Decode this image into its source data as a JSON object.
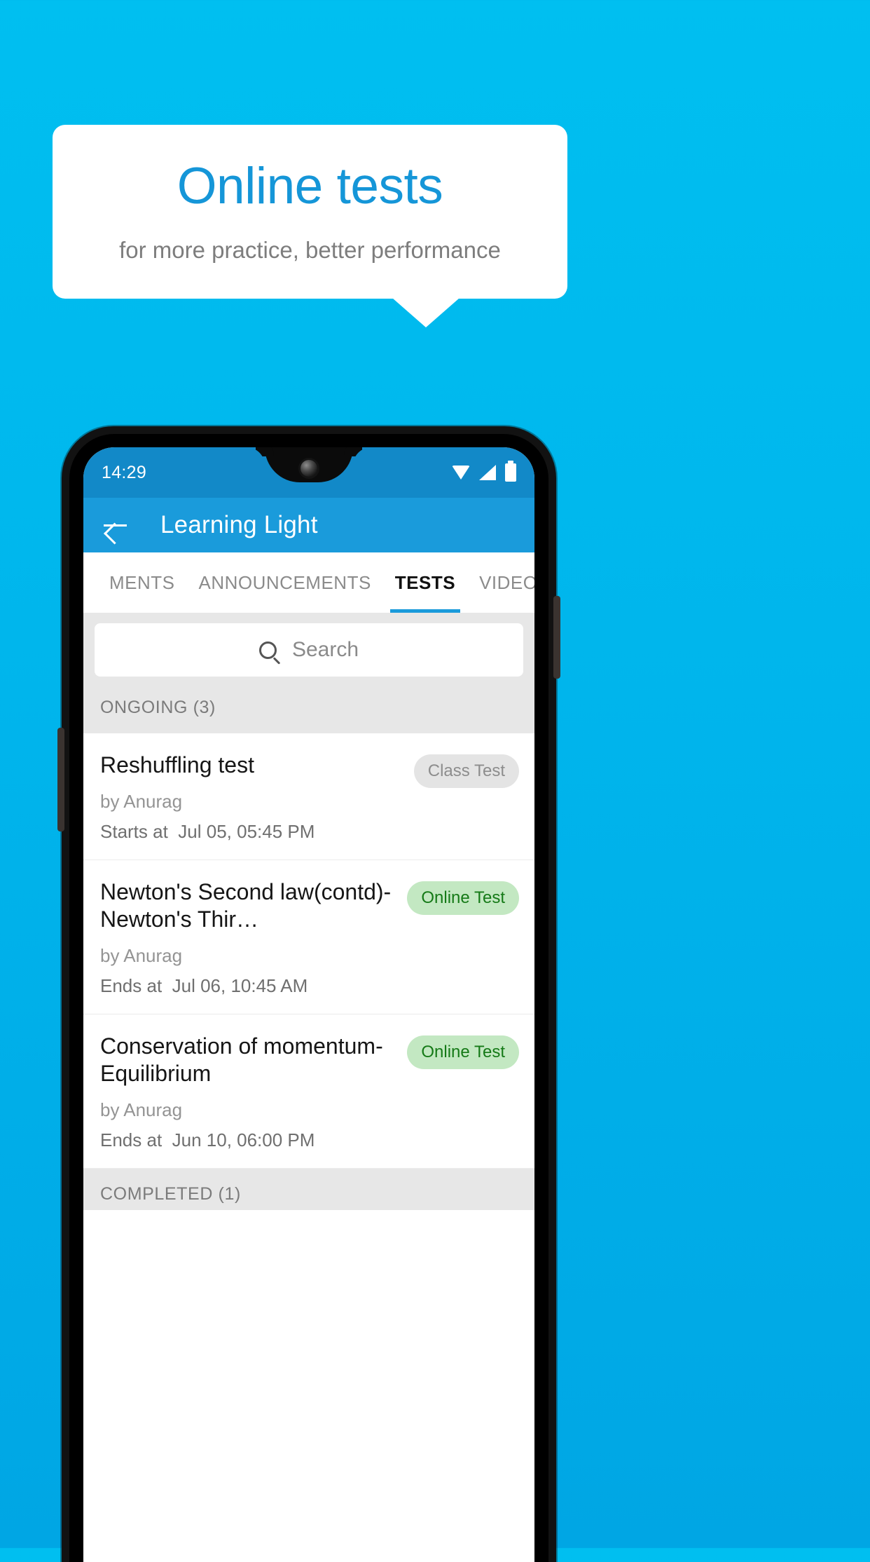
{
  "promo": {
    "title": "Online tests",
    "subtitle": "for more practice, better performance",
    "title_color": "#1596D8",
    "subtitle_color": "#7d7d7d",
    "background_top": "#00BFF0",
    "background_bottom": "#00A6E4"
  },
  "status_bar": {
    "time": "14:29",
    "icons": [
      "wifi-icon",
      "signal-icon",
      "battery-icon"
    ]
  },
  "app_bar": {
    "back_icon": "back-arrow-icon",
    "title": "Learning Light",
    "color": "#1A9BDB"
  },
  "tabs": [
    {
      "label": "MENTS",
      "active": false
    },
    {
      "label": "ANNOUNCEMENTS",
      "active": false
    },
    {
      "label": "TESTS",
      "active": true
    },
    {
      "label": "VIDEOS",
      "active": false
    }
  ],
  "search": {
    "icon": "search-icon",
    "placeholder": "Search",
    "value": ""
  },
  "sections": [
    {
      "label": "ONGOING (3)"
    },
    {
      "label": "COMPLETED (1)"
    }
  ],
  "tests": [
    {
      "title": "Reshuffling test",
      "author": "by Anurag",
      "schedule_label": "Starts at",
      "schedule_value": "Jul 05, 05:45 PM",
      "badge": "Class Test",
      "badge_type": "class",
      "badge_bg": "#e4e4e4",
      "badge_fg": "#8d8d8d"
    },
    {
      "title": "Newton's Second law(contd)-Newton's Thir…",
      "author": "by Anurag",
      "schedule_label": "Ends at",
      "schedule_value": "Jul 06, 10:45 AM",
      "badge": "Online Test",
      "badge_type": "online",
      "badge_bg": "#c3e8c2",
      "badge_fg": "#157a17"
    },
    {
      "title": "Conservation of momentum-Equilibrium",
      "author": "by Anurag",
      "schedule_label": "Ends at",
      "schedule_value": "Jun 10, 06:00 PM",
      "badge": "Online Test",
      "badge_type": "online",
      "badge_bg": "#c3e8c2",
      "badge_fg": "#157a17"
    }
  ]
}
